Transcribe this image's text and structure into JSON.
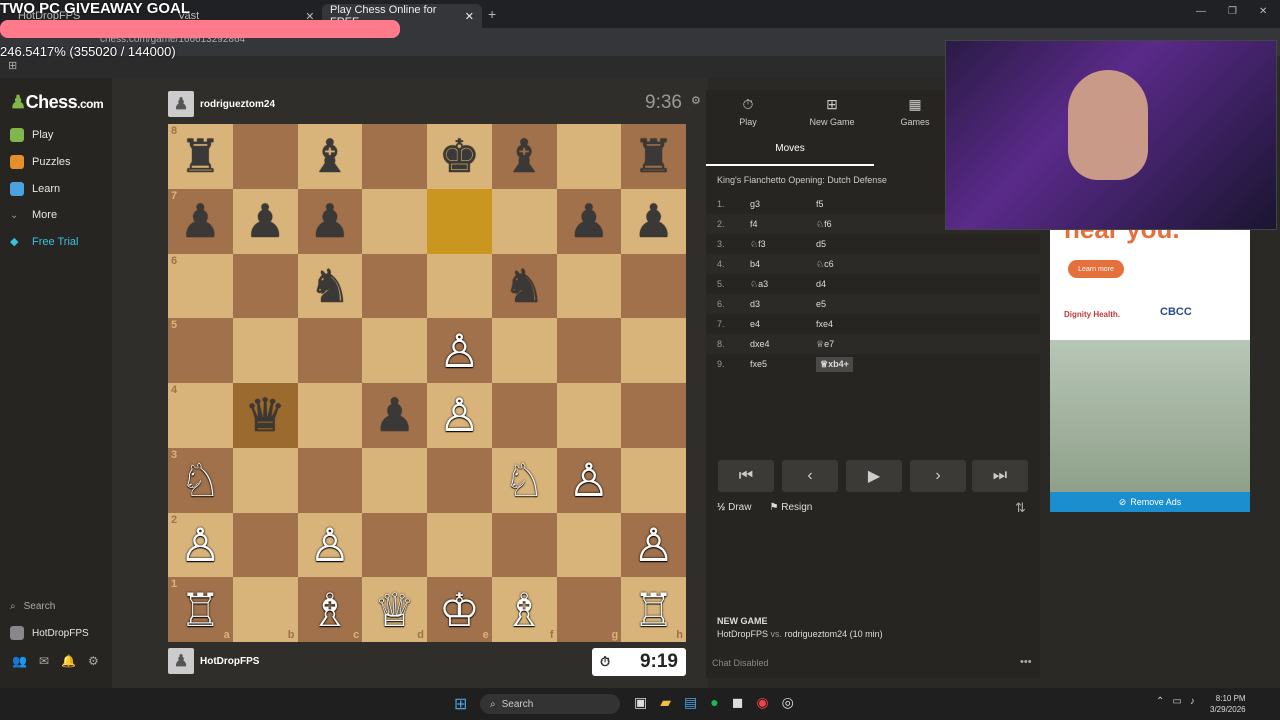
{
  "overlay": {
    "goal_title": "TWO PC GIVEAWAY GOAL",
    "goal_progress_text": "246.5417% (355020 / 144000)",
    "goal_progress": 1.0
  },
  "browser": {
    "tabs": [
      {
        "label": "HotDropFPS"
      },
      {
        "label": "Vast"
      },
      {
        "label": "Play Chess Online for FREE"
      }
    ],
    "url": "chess.com/game/166613292864"
  },
  "sidebar": {
    "logo": "Chess",
    "logo_suffix": ".com",
    "items": [
      {
        "label": "Play",
        "icon": "play-icon",
        "color": "#81b64c"
      },
      {
        "label": "Puzzles",
        "icon": "puzzle-icon",
        "color": "#e58f2a"
      },
      {
        "label": "Learn",
        "icon": "learn-icon",
        "color": "#4aa3df"
      },
      {
        "label": "More",
        "icon": "chevron-down-icon",
        "color": "#999"
      },
      {
        "label": "Free Trial",
        "icon": "diamond-icon",
        "color": "#38c2e0"
      }
    ],
    "search": "Search",
    "user": "HotDropFPS"
  },
  "game": {
    "top_player": "rodrigueztom24",
    "top_clock": "9:36",
    "bottom_player": "HotDropFPS",
    "bottom_clock": "9:19",
    "board": [
      [
        "♜",
        "",
        "♝",
        "",
        "♚",
        "♝",
        "",
        "♜"
      ],
      [
        "♟",
        "♟",
        "♟",
        "",
        "",
        "",
        "♟",
        "♟"
      ],
      [
        "",
        "",
        "♞",
        "",
        "",
        "♞",
        "",
        ""
      ],
      [
        "",
        "",
        "",
        "",
        "♙",
        "",
        "",
        ""
      ],
      [
        "",
        "♛",
        "",
        "♟",
        "♙",
        "",
        "",
        ""
      ],
      [
        "♘",
        "",
        "",
        "",
        "",
        "♘",
        "♙",
        ""
      ],
      [
        "♙",
        "",
        "♙",
        "",
        "",
        "",
        "",
        "♙"
      ],
      [
        "♖",
        "",
        "♗",
        "♕",
        "♔",
        "♗",
        "",
        "♖"
      ]
    ],
    "files": [
      "a",
      "b",
      "c",
      "d",
      "e",
      "f",
      "g",
      "h"
    ],
    "ranks": [
      "8",
      "7",
      "6",
      "5",
      "4",
      "3",
      "2",
      "1"
    ]
  },
  "panel": {
    "tabs": [
      {
        "label": "Play",
        "icon": "stopwatch-icon"
      },
      {
        "label": "New Game",
        "icon": "plus-icon"
      },
      {
        "label": "Games",
        "icon": "board-icon"
      }
    ],
    "moves_tab": "Moves",
    "opening": "King's Fianchetto Opening: Dutch Defense",
    "moves": [
      {
        "n": "1.",
        "w": "g3",
        "b": "f5"
      },
      {
        "n": "2.",
        "w": "f4",
        "b": "♘f6"
      },
      {
        "n": "3.",
        "w": "♘f3",
        "b": "d5"
      },
      {
        "n": "4.",
        "w": "b4",
        "b": "♘c6"
      },
      {
        "n": "5.",
        "w": "♘a3",
        "b": "d4"
      },
      {
        "n": "6.",
        "w": "d3",
        "b": "e5"
      },
      {
        "n": "7.",
        "w": "e4",
        "b": "fxe4"
      },
      {
        "n": "8.",
        "w": "dxe4",
        "b": "♕e7"
      },
      {
        "n": "9.",
        "w": "fxe5",
        "b": "♕xb4+"
      }
    ],
    "draw": "Draw",
    "resign": "Resign",
    "new_game_title": "NEW GAME",
    "new_game_white": "HotDropFPS",
    "new_game_vs": "vs.",
    "new_game_black": "rodrigueztom24",
    "new_game_time": "(10 min)",
    "chat": "Chat Disabled"
  },
  "ad": {
    "headline": "hear you.",
    "learn_more": "Learn more",
    "brand1": "Dignity Health.",
    "brand2": "CBCC",
    "remove_ads": "Remove Ads"
  },
  "taskbar": {
    "search": "Search",
    "time": "8:10 PM",
    "date": "3/29/2026"
  }
}
